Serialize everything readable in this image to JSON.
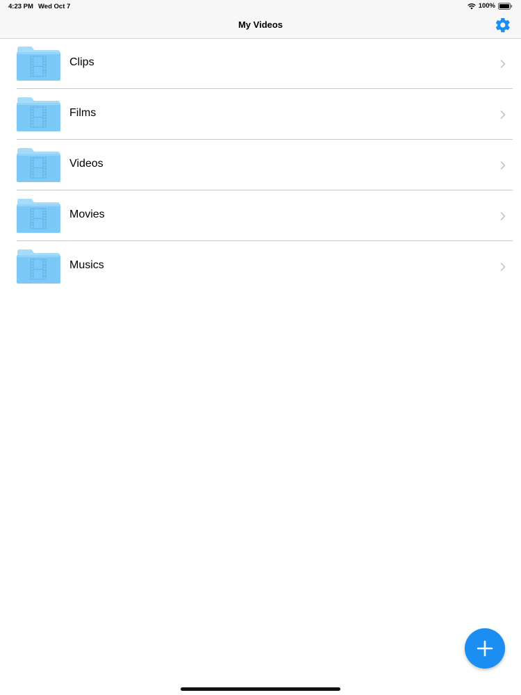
{
  "status_bar": {
    "time": "4:23 PM",
    "date": "Wed Oct 7",
    "battery_percent": "100%",
    "battery_level": 1.0
  },
  "nav": {
    "title": "My Videos",
    "settings_icon": "gear-icon"
  },
  "folders": [
    {
      "label": "Clips",
      "icon": "folder-film-icon"
    },
    {
      "label": "Films",
      "icon": "folder-film-icon"
    },
    {
      "label": "Videos",
      "icon": "folder-film-icon"
    },
    {
      "label": "Movies",
      "icon": "folder-film-icon"
    },
    {
      "label": "Musics",
      "icon": "folder-film-icon"
    }
  ],
  "fab": {
    "icon": "plus-icon"
  },
  "colors": {
    "accent": "#1a8ef2",
    "folder": "#7cc8f7",
    "folder_tab": "#a6dbfa",
    "divider": "#c8c8c8"
  }
}
